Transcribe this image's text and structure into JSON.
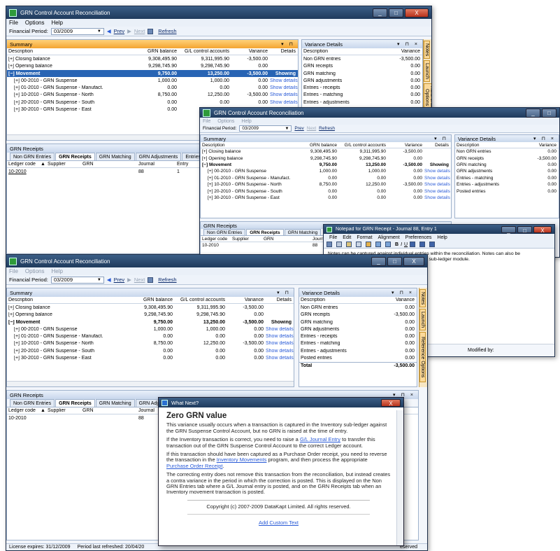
{
  "app": {
    "title": "GRN Control Account Reconciliation",
    "menu": [
      "File",
      "Options",
      "Help"
    ],
    "period_label": "Financial Period:",
    "period_value": "03/2009",
    "prev": "Prev",
    "next": "Next",
    "refresh": "Refresh",
    "window_buttons": {
      "minimize": "_",
      "maximize": "□",
      "close": "X"
    }
  },
  "summary": {
    "title": "Summary",
    "pin": "▾ ⊓",
    "columns": [
      "Description",
      "GRN balance",
      "G/L control accounts",
      "Variance",
      "Details"
    ],
    "rows": [
      {
        "desc": "Closing balance",
        "grn": "9,308,495.90",
        "gl": "9,311,995.90",
        "var": "-3,500.00",
        "det": "",
        "level": 0,
        "expander": "+"
      },
      {
        "desc": "Opening balance",
        "grn": "9,298,745.90",
        "gl": "9,298,745.90",
        "var": "0.00",
        "det": "",
        "level": 0,
        "expander": "+"
      },
      {
        "desc": "Movement",
        "grn": "9,750.00",
        "gl": "13,250.00",
        "var": "-3,500.00",
        "det": "Showing",
        "level": 0,
        "expander": "−"
      },
      {
        "desc": "00-2010 - GRN Suspense",
        "grn": "1,000.00",
        "gl": "1,000.00",
        "var": "0.00",
        "det": "Show details",
        "level": 1,
        "expander": "+"
      },
      {
        "desc": "01-2010 - GRN Suspense - Manufact.",
        "grn": "0.00",
        "gl": "0.00",
        "var": "0.00",
        "det": "Show details",
        "level": 1,
        "expander": "+"
      },
      {
        "desc": "10-2010 - GRN Suspense - North",
        "grn": "8,750.00",
        "gl": "12,250.00",
        "var": "-3,500.00",
        "det": "Show details",
        "level": 1,
        "expander": "+"
      },
      {
        "desc": "20-2010 - GRN Suspense - South",
        "grn": "0.00",
        "gl": "0.00",
        "var": "0.00",
        "det": "Show details",
        "level": 1,
        "expander": "+"
      },
      {
        "desc": "30-2010 - GRN Suspense - East",
        "grn": "0.00",
        "gl": "0.00",
        "var": "0.00",
        "det": "Show details",
        "level": 1,
        "expander": "+"
      }
    ]
  },
  "variance": {
    "title": "Variance Details",
    "pin": "▾ ⊓ ×",
    "columns": [
      "Description",
      "Variance"
    ],
    "rows": [
      {
        "desc": "Non GRN entries",
        "val": "0.00"
      },
      {
        "desc": "GRN receipts",
        "val": "-3,500.00"
      },
      {
        "desc": "GRN matching",
        "val": "0.00"
      },
      {
        "desc": "GRN adjustments",
        "val": "0.00"
      },
      {
        "desc": "Entries - receipts",
        "val": "0.00"
      },
      {
        "desc": "Entries - matching",
        "val": "0.00"
      },
      {
        "desc": "Entries - adjustments",
        "val": "0.00"
      },
      {
        "desc": "Posted entries",
        "val": "0.00"
      }
    ],
    "total_label": "Total",
    "total_value": "-3,500.00"
  },
  "win1": {
    "variance_rows": [
      {
        "desc": "Non GRN entries",
        "val": "-3,500.00"
      },
      {
        "desc": "GRN receipts",
        "val": "0.00"
      },
      {
        "desc": "GRN matching",
        "val": "0.00"
      },
      {
        "desc": "GRN adjustments",
        "val": "0.00"
      },
      {
        "desc": "Entries - receipts",
        "val": "0.00"
      },
      {
        "desc": "Entries - matching",
        "val": "0.00"
      },
      {
        "desc": "Entries - adjustments",
        "val": "0.00"
      }
    ],
    "movement_var": "-3,500.00"
  },
  "win2": {
    "variance_rows": [
      {
        "desc": "Non GRN entries",
        "val": "0.00"
      },
      {
        "desc": "GRN receipts",
        "val": "-3,500.00"
      },
      {
        "desc": "GRN matching",
        "val": "0.00"
      },
      {
        "desc": "GRN adjustments",
        "val": "0.00"
      },
      {
        "desc": "Entries - matching",
        "val": "0.00"
      },
      {
        "desc": "Entries - adjustments",
        "val": "0.00"
      },
      {
        "desc": "Posted entries",
        "val": "0.00"
      }
    ]
  },
  "side_tabs": [
    "Notes",
    "Launch",
    "Reference Options"
  ],
  "receipts": {
    "title": "GRN Receipts",
    "tabs": [
      "Non GRN Entries",
      "GRN Receipts",
      "GRN Matching",
      "GRN Adjustments",
      "Entries"
    ],
    "columns": [
      "Ledger code",
      "Supplier",
      "GRN",
      "Journal",
      "Entry"
    ],
    "sort_indicator": "▲",
    "row": {
      "ledger": "10-2010",
      "journal": "88",
      "entry": "1"
    }
  },
  "notepad": {
    "title": "Notepad for GRN Receipt - Journal 88, Entry 1",
    "menu": [
      "File",
      "Edit",
      "Format",
      "Alignment",
      "Preferences",
      "Help"
    ],
    "text": "Notes can be captured against individual entries within the reconciliation. Notes can also be captured at the 'Financial period' level or for the sub-ledger module.",
    "modified_label": "Modified by:"
  },
  "whatnext": {
    "title": "What Next?",
    "heading": "Zero GRN value",
    "p1": "This variance usually occurs when a transaction is captured in the Inventory sub-ledger against the GRN Suspense Control Account, but no GRN is raised at the time of entry.",
    "p2a": "If the Inventory transaction is correct, you need to raise a ",
    "p2link": "G/L Journal Entry",
    "p2b": " to transfer this transaction out of the GRN Suspense Control Account to the correct Ledger account.",
    "p3a": "If this transaction should have been captured as a Purchase Order receipt, you need to reverse the transaction in the ",
    "p3link1": "Inventory Movements",
    "p3b": " program, and then process the appropriate ",
    "p3link2": "Purchase Order Receipt",
    "p3c": ".",
    "p4": "The correcting entry does not remove this transaction from the reconciliation, but instead creates a contra variance in the period in which the correction is posted. This is displayed on the Non GRN Entries tab where a G/L Journal entry is posted, and on the GRN Receipts tab when an Inventory movement transaction is posted.",
    "copyright": "Copyright (c) 2007-2009 DataKapt Limited. All rights reserved.",
    "add_custom": "Add Custom Text"
  },
  "statusbar": {
    "license": "License expires: 31/12/2009",
    "refreshed": "Period last refreshed: 20/04/20",
    "reserved": "eserved"
  },
  "colors": {
    "accent_orange": "#f4a431",
    "selection": "#2864b4",
    "title_bar": "#1f3a5c",
    "link": "#2a5bd7"
  }
}
